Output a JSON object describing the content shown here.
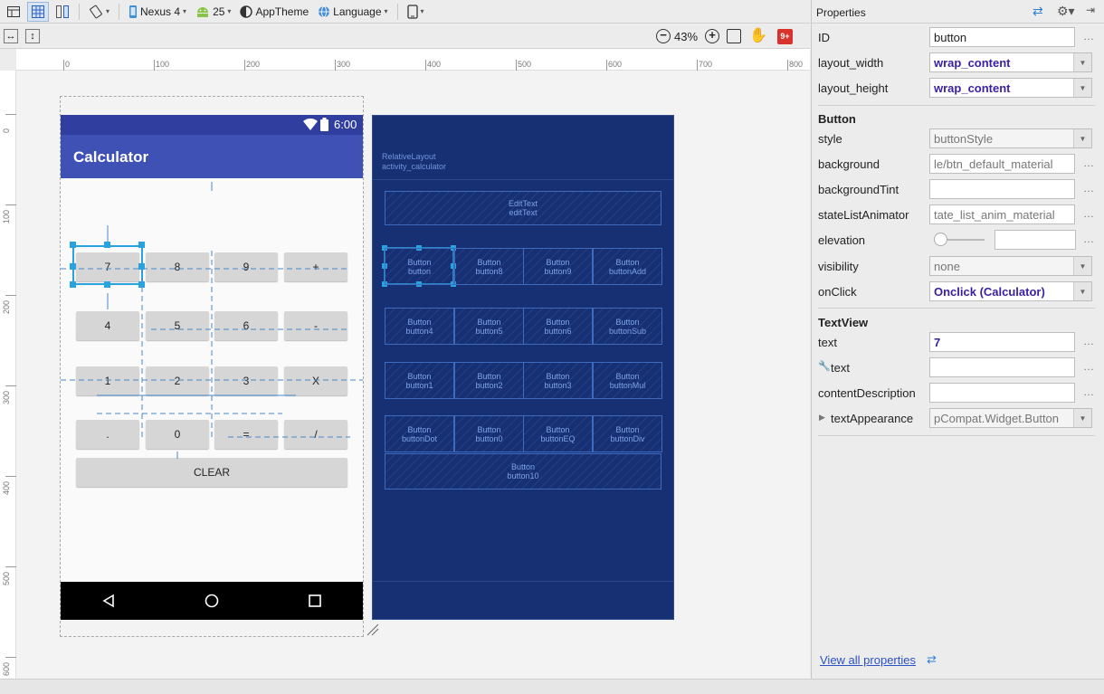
{
  "toolbar": {
    "device": "Nexus 4",
    "api": "25",
    "theme": "AppTheme",
    "language": "Language",
    "zoom": "43%",
    "notification_badge": "9+"
  },
  "ruler": {
    "h_ticks": [
      "0",
      "100",
      "200",
      "300",
      "400",
      "500",
      "600",
      "700",
      "800"
    ],
    "v_ticks": [
      "0",
      "100",
      "200",
      "300",
      "400",
      "500",
      "600"
    ]
  },
  "phone": {
    "time": "6:00",
    "app_title": "Calculator",
    "keys": [
      "7",
      "8",
      "9",
      "+",
      "4",
      "5",
      "6",
      "-",
      "1",
      "2",
      "3",
      "X",
      ".",
      "0",
      "=",
      "/"
    ],
    "clear": "CLEAR"
  },
  "blueprint": {
    "root_type": "RelativeLayout",
    "root_id": "activity_calculator",
    "edit_type": "EditText",
    "edit_id": "editText",
    "widget_type": "Button",
    "button_ids": [
      "button",
      "button8",
      "button9",
      "buttonAdd",
      "button4",
      "button5",
      "button6",
      "buttonSub",
      "button1",
      "button2",
      "button3",
      "buttonMul",
      "buttonDot",
      "button0",
      "buttonEQ",
      "buttonDiv"
    ],
    "clear_id": "button10"
  },
  "properties": {
    "title": "Properties",
    "rows_top": [
      {
        "label": "ID",
        "value": "button"
      },
      {
        "label": "layout_width",
        "value": "wrap_content"
      },
      {
        "label": "layout_height",
        "value": "wrap_content"
      }
    ],
    "button_section": "Button",
    "button_rows": [
      {
        "label": "style",
        "value": "buttonStyle"
      },
      {
        "label": "background",
        "value": "le/btn_default_material"
      },
      {
        "label": "backgroundTint",
        "value": ""
      },
      {
        "label": "stateListAnimator",
        "value": "tate_list_anim_material"
      },
      {
        "label": "elevation",
        "value": ""
      },
      {
        "label": "visibility",
        "value": "none"
      },
      {
        "label": "onClick",
        "value": "Onclick (Calculator)"
      }
    ],
    "textview_section": "TextView",
    "textview_rows": [
      {
        "label": "text",
        "value": "7"
      },
      {
        "label": "text",
        "value": ""
      },
      {
        "label": "contentDescription",
        "value": ""
      },
      {
        "label": "textAppearance",
        "value": "pCompat.Widget.Button"
      }
    ],
    "more": "…",
    "view_all": "View all properties"
  },
  "colors": {
    "app_bar": "#3f51b5",
    "status_bar": "#303f9f",
    "blueprint_bg": "#173073",
    "selection": "#29a3e0"
  }
}
